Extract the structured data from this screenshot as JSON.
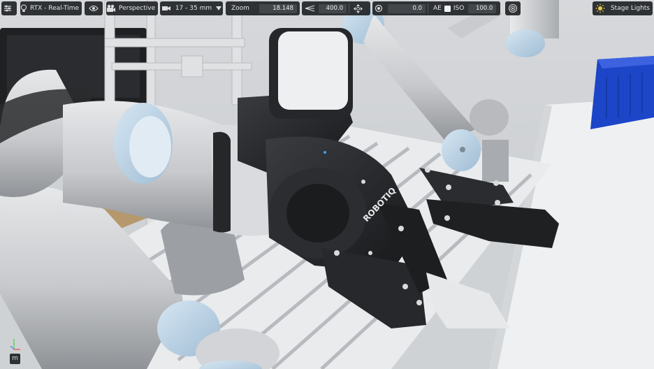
{
  "toolbar": {
    "renderer": "RTX - Real-Time",
    "camera": "Perspective",
    "lens": "17 - 35 mm",
    "zoom_label": "Zoom",
    "zoom_value": "18.148",
    "speed_value": "400.0",
    "rotate_value": "0.0",
    "ae_label": "AE",
    "iso_label": "ISO",
    "iso_value": "100.0",
    "stage_lights": "Stage Lights"
  },
  "scene": {
    "gripper_brand": "ROBOTIQ"
  },
  "bottom": {
    "units_button": "m"
  },
  "colors": {
    "toolbar_bg": "#181a1d",
    "field_bg": "#43474c",
    "gripper_black": "#222326",
    "arm_gray": "#cfd1d4",
    "joint_blue": "#b9d3e6",
    "bin_blue": "#1c45c8",
    "accent_yellow": "#e8c84a"
  },
  "icons": [
    "settings-sliders-icon",
    "bulb-icon",
    "eye-icon",
    "camera-icon",
    "film-camera-icon",
    "chevron-down-icon",
    "speed-icon",
    "move-icon",
    "camera-settings-icon",
    "record-icon",
    "light-icon",
    "axis-icon"
  ]
}
